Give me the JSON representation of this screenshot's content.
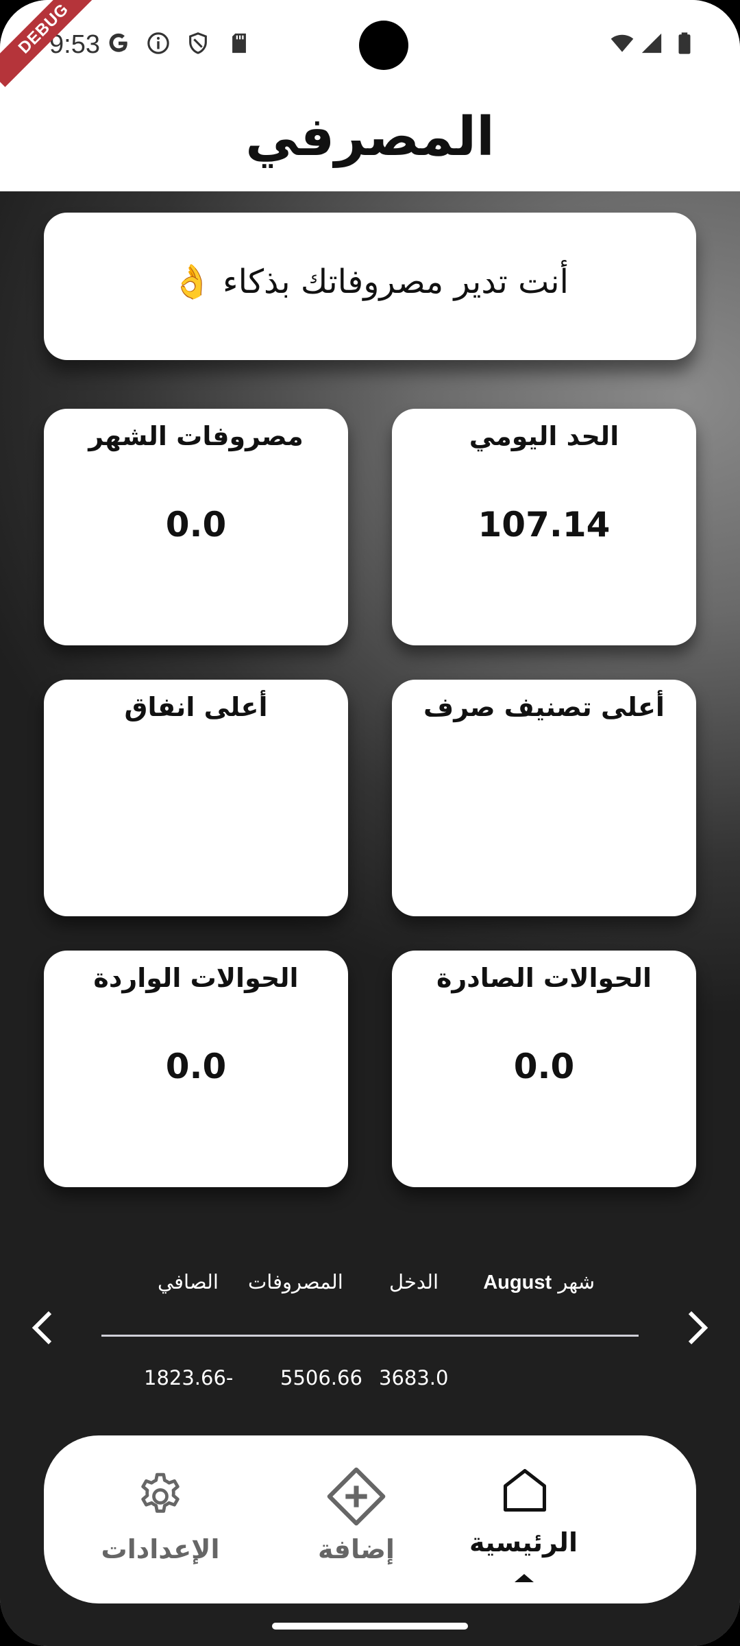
{
  "status_bar": {
    "time": "9:53",
    "debug_banner": "DEBUG"
  },
  "app_bar": {
    "title": "المصرفي"
  },
  "banner": {
    "text": "أنت تدير مصروفاتك بذكاء 👌"
  },
  "cards": {
    "daily_limit": {
      "title": "الحد اليومي",
      "value": "107.14"
    },
    "month_expenses": {
      "title": "مصروفات الشهر",
      "value": "0.0"
    },
    "top_category": {
      "title": "أعلى تصنيف صرف",
      "value": ""
    },
    "top_spending": {
      "title": "أعلى انفاق",
      "value": ""
    },
    "outgoing_transfers": {
      "title": "الحوالات الصادرة",
      "value": "0.0"
    },
    "incoming_transfers": {
      "title": "الحوالات الواردة",
      "value": "0.0"
    }
  },
  "summary": {
    "month_prefix": "شهر",
    "month_name": "August",
    "income_label": "الدخل",
    "expenses_label": "المصروفات",
    "net_label": "الصافي",
    "income_value": "3683.0",
    "expenses_value": "5506.66",
    "net_value": "1823.66-"
  },
  "nav": {
    "home": "الرئيسية",
    "add": "إضافة",
    "settings": "الإعدادات",
    "active": "home"
  },
  "icons": [
    "google-icon",
    "info-icon",
    "shield-icon",
    "sd-card-icon",
    "wifi-icon",
    "signal-icon",
    "battery-icon",
    "chevron-left-icon",
    "chevron-right-icon",
    "home-icon",
    "add-icon",
    "gear-icon"
  ]
}
